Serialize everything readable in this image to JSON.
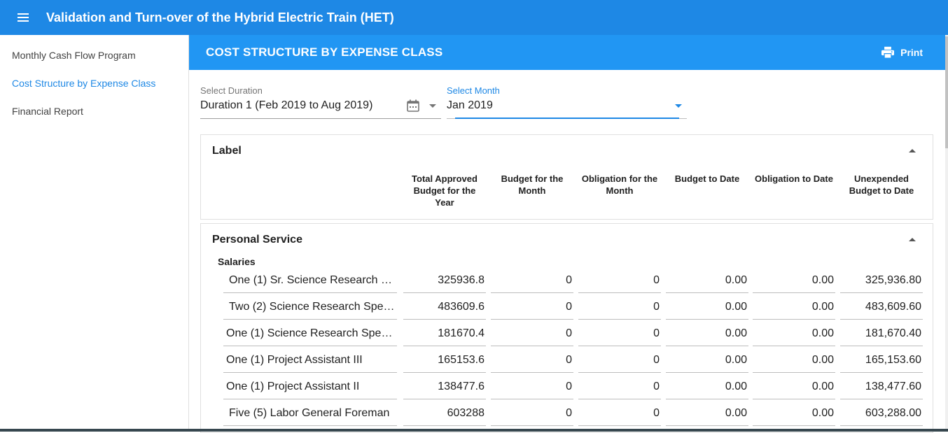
{
  "appbar": {
    "title": "Validation and Turn-over of the Hybrid Electric Train (HET)",
    "menu_icon": "hamburger-menu-icon",
    "color": "#1e88e5"
  },
  "sidebar": {
    "items": [
      {
        "label": "Monthly Cash Flow Program",
        "active": false
      },
      {
        "label": "Cost Structure by Expense Class",
        "active": true
      },
      {
        "label": "Financial Report",
        "active": false
      }
    ]
  },
  "section": {
    "title": "COST STRUCTURE BY EXPENSE CLASS",
    "print_label": "Print",
    "print_icon": "printer-icon",
    "color": "#2196f3"
  },
  "filters": {
    "duration": {
      "label": "Select Duration",
      "value": "Duration 1 (Feb 2019 to Aug 2019)"
    },
    "month": {
      "label": "Select Month",
      "value": "Jan 2019"
    }
  },
  "label_card": {
    "title": "Label",
    "columns": [
      "Total Approved Budget for the Year",
      "Budget for the Month",
      "Obligation for the Month",
      "Budget to Date",
      "Obligation to Date",
      "Unexpended Budget to Date"
    ]
  },
  "personal_service": {
    "title": "Personal Service",
    "subgroup": "Salaries",
    "rows": [
      {
        "label": "One (1) Sr. Science Research S...",
        "c1": "325936.8",
        "c2": "0",
        "c3": "0",
        "c4": "0.00",
        "c5": "0.00",
        "c6": "325,936.80"
      },
      {
        "label": "Two (2) Science Research Spec...",
        "c1": "483609.6",
        "c2": "0",
        "c3": "0",
        "c4": "0.00",
        "c5": "0.00",
        "c6": "483,609.60"
      },
      {
        "label": "One (1) Science Research Speci...",
        "c1": "181670.4",
        "c2": "0",
        "c3": "0",
        "c4": "0.00",
        "c5": "0.00",
        "c6": "181,670.40"
      },
      {
        "label": "One (1) Project Assistant III",
        "c1": "165153.6",
        "c2": "0",
        "c3": "0",
        "c4": "0.00",
        "c5": "0.00",
        "c6": "165,153.60"
      },
      {
        "label": "One (1) Project Assistant II",
        "c1": "138477.6",
        "c2": "0",
        "c3": "0",
        "c4": "0.00",
        "c5": "0.00",
        "c6": "138,477.60"
      },
      {
        "label": "Five (5) Labor General Foreman",
        "c1": "603288",
        "c2": "0",
        "c3": "0",
        "c4": "0.00",
        "c5": "0.00",
        "c6": "603,288.00"
      }
    ]
  }
}
